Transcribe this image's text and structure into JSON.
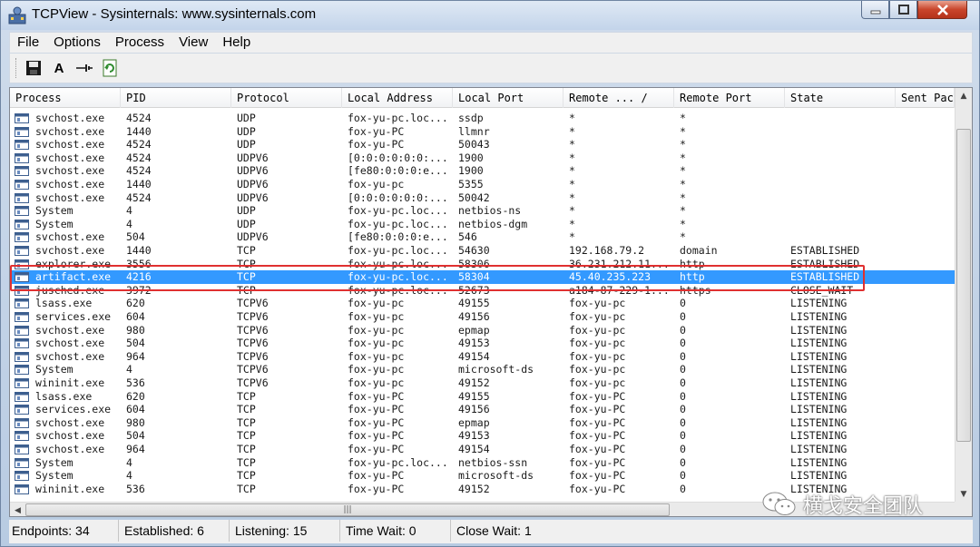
{
  "window": {
    "title": "TCPView - Sysinternals: www.sysinternals.com"
  },
  "menu": [
    "File",
    "Options",
    "Process",
    "View",
    "Help"
  ],
  "toolbar": {
    "icons": [
      "save-icon",
      "font-icon",
      "connect-icon",
      "refresh-icon"
    ],
    "font_glyph": "A"
  },
  "columns": [
    "Process",
    "PID",
    "Protocol",
    "Local Address",
    "Local Port",
    "Remote ...  /",
    "Remote Port",
    "State",
    "Sent Pac"
  ],
  "rows": [
    {
      "process": "svchost.exe",
      "pid": "4524",
      "protocol": "UDP",
      "local_address": "fox-yu-pc.loc...",
      "local_port": "ssdp",
      "remote_address": "*",
      "remote_port": "*",
      "state": ""
    },
    {
      "process": "svchost.exe",
      "pid": "1440",
      "protocol": "UDP",
      "local_address": "fox-yu-PC",
      "local_port": "llmnr",
      "remote_address": "*",
      "remote_port": "*",
      "state": ""
    },
    {
      "process": "svchost.exe",
      "pid": "4524",
      "protocol": "UDP",
      "local_address": "fox-yu-PC",
      "local_port": "50043",
      "remote_address": "*",
      "remote_port": "*",
      "state": ""
    },
    {
      "process": "svchost.exe",
      "pid": "4524",
      "protocol": "UDPV6",
      "local_address": "[0:0:0:0:0:0:...",
      "local_port": "1900",
      "remote_address": "*",
      "remote_port": "*",
      "state": ""
    },
    {
      "process": "svchost.exe",
      "pid": "4524",
      "protocol": "UDPV6",
      "local_address": "[fe80:0:0:0:e...",
      "local_port": "1900",
      "remote_address": "*",
      "remote_port": "*",
      "state": ""
    },
    {
      "process": "svchost.exe",
      "pid": "1440",
      "protocol": "UDPV6",
      "local_address": "fox-yu-pc",
      "local_port": "5355",
      "remote_address": "*",
      "remote_port": "*",
      "state": ""
    },
    {
      "process": "svchost.exe",
      "pid": "4524",
      "protocol": "UDPV6",
      "local_address": "[0:0:0:0:0:0:...",
      "local_port": "50042",
      "remote_address": "*",
      "remote_port": "*",
      "state": ""
    },
    {
      "process": "System",
      "pid": "4",
      "protocol": "UDP",
      "local_address": "fox-yu-pc.loc...",
      "local_port": "netbios-ns",
      "remote_address": "*",
      "remote_port": "*",
      "state": ""
    },
    {
      "process": "System",
      "pid": "4",
      "protocol": "UDP",
      "local_address": "fox-yu-pc.loc...",
      "local_port": "netbios-dgm",
      "remote_address": "*",
      "remote_port": "*",
      "state": ""
    },
    {
      "process": "svchost.exe",
      "pid": "504",
      "protocol": "UDPV6",
      "local_address": "[fe80:0:0:0:e...",
      "local_port": "546",
      "remote_address": "*",
      "remote_port": "*",
      "state": ""
    },
    {
      "process": "svchost.exe",
      "pid": "1440",
      "protocol": "TCP",
      "local_address": "fox-yu-pc.loc...",
      "local_port": "54630",
      "remote_address": "192.168.79.2",
      "remote_port": "domain",
      "state": "ESTABLISHED"
    },
    {
      "process": "explorer.exe",
      "pid": "3556",
      "protocol": "TCP",
      "local_address": "fox-yu-pc.loc...",
      "local_port": "58306",
      "remote_address": "36.231.212.11...",
      "remote_port": "http",
      "state": "ESTABLISHED"
    },
    {
      "process": "artifact.exe",
      "pid": "4216",
      "protocol": "TCP",
      "local_address": "fox-yu-pc.loc...",
      "local_port": "58304",
      "remote_address": "45.40.235.223",
      "remote_port": "http",
      "state": "ESTABLISHED",
      "selected": true
    },
    {
      "process": "jusched.exe",
      "pid": "3972",
      "protocol": "TCP",
      "local_address": "fox-yu-pc.loc...",
      "local_port": "52673",
      "remote_address": "a184-87-229-1...",
      "remote_port": "https",
      "state": "CLOSE_WAIT"
    },
    {
      "process": "lsass.exe",
      "pid": "620",
      "protocol": "TCPV6",
      "local_address": "fox-yu-pc",
      "local_port": "49155",
      "remote_address": "fox-yu-pc",
      "remote_port": "0",
      "state": "LISTENING"
    },
    {
      "process": "services.exe",
      "pid": "604",
      "protocol": "TCPV6",
      "local_address": "fox-yu-pc",
      "local_port": "49156",
      "remote_address": "fox-yu-pc",
      "remote_port": "0",
      "state": "LISTENING"
    },
    {
      "process": "svchost.exe",
      "pid": "980",
      "protocol": "TCPV6",
      "local_address": "fox-yu-pc",
      "local_port": "epmap",
      "remote_address": "fox-yu-pc",
      "remote_port": "0",
      "state": "LISTENING"
    },
    {
      "process": "svchost.exe",
      "pid": "504",
      "protocol": "TCPV6",
      "local_address": "fox-yu-pc",
      "local_port": "49153",
      "remote_address": "fox-yu-pc",
      "remote_port": "0",
      "state": "LISTENING"
    },
    {
      "process": "svchost.exe",
      "pid": "964",
      "protocol": "TCPV6",
      "local_address": "fox-yu-pc",
      "local_port": "49154",
      "remote_address": "fox-yu-pc",
      "remote_port": "0",
      "state": "LISTENING"
    },
    {
      "process": "System",
      "pid": "4",
      "protocol": "TCPV6",
      "local_address": "fox-yu-pc",
      "local_port": "microsoft-ds",
      "remote_address": "fox-yu-pc",
      "remote_port": "0",
      "state": "LISTENING"
    },
    {
      "process": "wininit.exe",
      "pid": "536",
      "protocol": "TCPV6",
      "local_address": "fox-yu-pc",
      "local_port": "49152",
      "remote_address": "fox-yu-pc",
      "remote_port": "0",
      "state": "LISTENING"
    },
    {
      "process": "lsass.exe",
      "pid": "620",
      "protocol": "TCP",
      "local_address": "fox-yu-PC",
      "local_port": "49155",
      "remote_address": "fox-yu-PC",
      "remote_port": "0",
      "state": "LISTENING"
    },
    {
      "process": "services.exe",
      "pid": "604",
      "protocol": "TCP",
      "local_address": "fox-yu-PC",
      "local_port": "49156",
      "remote_address": "fox-yu-PC",
      "remote_port": "0",
      "state": "LISTENING"
    },
    {
      "process": "svchost.exe",
      "pid": "980",
      "protocol": "TCP",
      "local_address": "fox-yu-PC",
      "local_port": "epmap",
      "remote_address": "fox-yu-PC",
      "remote_port": "0",
      "state": "LISTENING"
    },
    {
      "process": "svchost.exe",
      "pid": "504",
      "protocol": "TCP",
      "local_address": "fox-yu-PC",
      "local_port": "49153",
      "remote_address": "fox-yu-PC",
      "remote_port": "0",
      "state": "LISTENING"
    },
    {
      "process": "svchost.exe",
      "pid": "964",
      "protocol": "TCP",
      "local_address": "fox-yu-PC",
      "local_port": "49154",
      "remote_address": "fox-yu-PC",
      "remote_port": "0",
      "state": "LISTENING"
    },
    {
      "process": "System",
      "pid": "4",
      "protocol": "TCP",
      "local_address": "fox-yu-pc.loc...",
      "local_port": "netbios-ssn",
      "remote_address": "fox-yu-PC",
      "remote_port": "0",
      "state": "LISTENING"
    },
    {
      "process": "System",
      "pid": "4",
      "protocol": "TCP",
      "local_address": "fox-yu-PC",
      "local_port": "microsoft-ds",
      "remote_address": "fox-yu-PC",
      "remote_port": "0",
      "state": "LISTENING"
    },
    {
      "process": "wininit.exe",
      "pid": "536",
      "protocol": "TCP",
      "local_address": "fox-yu-PC",
      "local_port": "49152",
      "remote_address": "fox-yu-PC",
      "remote_port": "0",
      "state": "LISTENING"
    }
  ],
  "status": {
    "endpoints": "Endpoints: 34",
    "established": "Established: 6",
    "listening": "Listening: 15",
    "time_wait": "Time Wait: 0",
    "close_wait": "Close Wait: 1"
  },
  "watermark": "横戈安全团队",
  "colors": {
    "selection": "#3399ff",
    "highlight_box": "#e03030"
  }
}
